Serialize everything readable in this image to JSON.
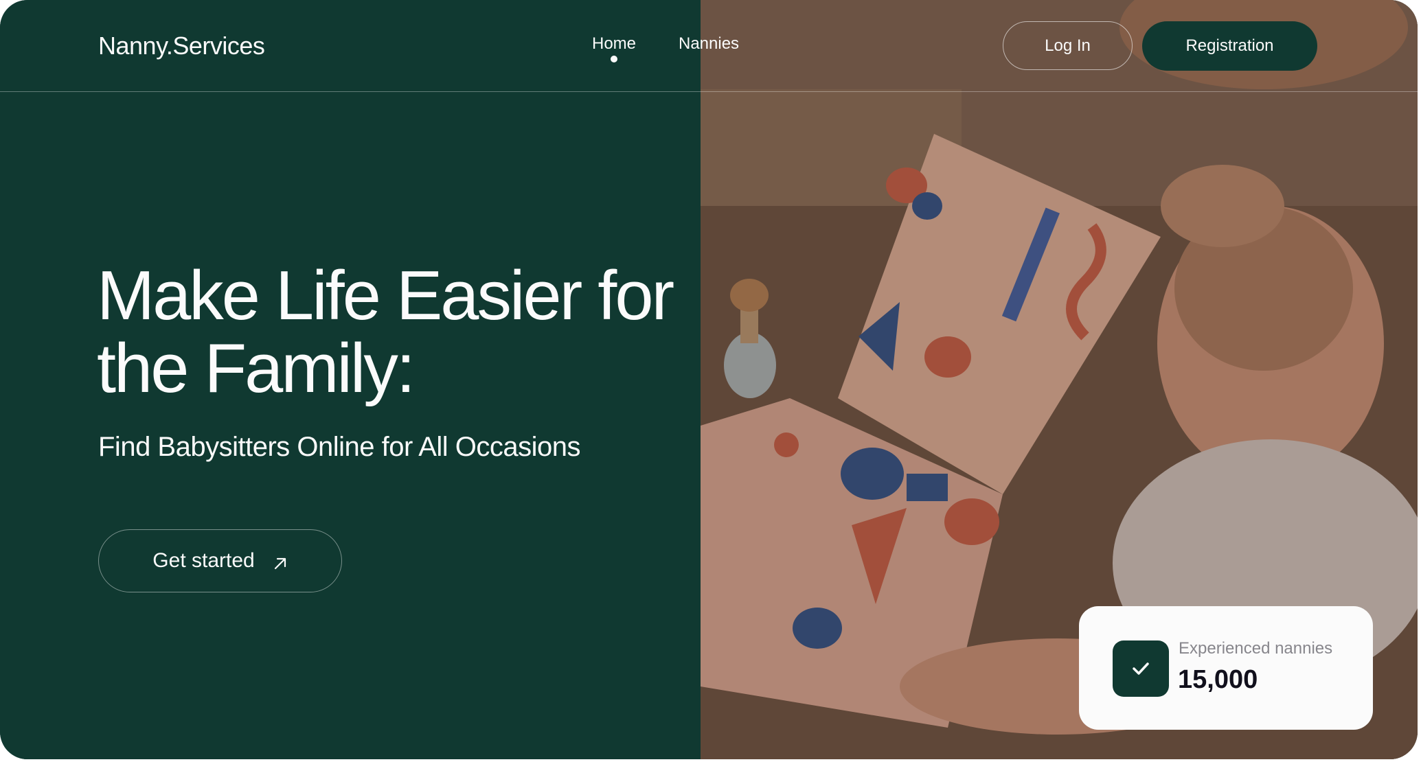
{
  "header": {
    "logo": "Nanny.Services",
    "nav": {
      "home": "Home",
      "nannies": "Nannies"
    },
    "login_label": "Log In",
    "register_label": "Registration"
  },
  "hero": {
    "headline": "Make Life Easier for the Family:",
    "subline": "Find Babysitters Online for All Occasions",
    "cta_label": "Get started",
    "cta_icon": "arrow-up-right-icon",
    "photo_alt": "baby-reading-book-photo"
  },
  "stat": {
    "icon": "check-icon",
    "label": "Experienced nannies",
    "value": "15,000"
  },
  "colors": {
    "brand": "#103931",
    "light": "#fbfbfb",
    "dark_text": "#11101c"
  }
}
